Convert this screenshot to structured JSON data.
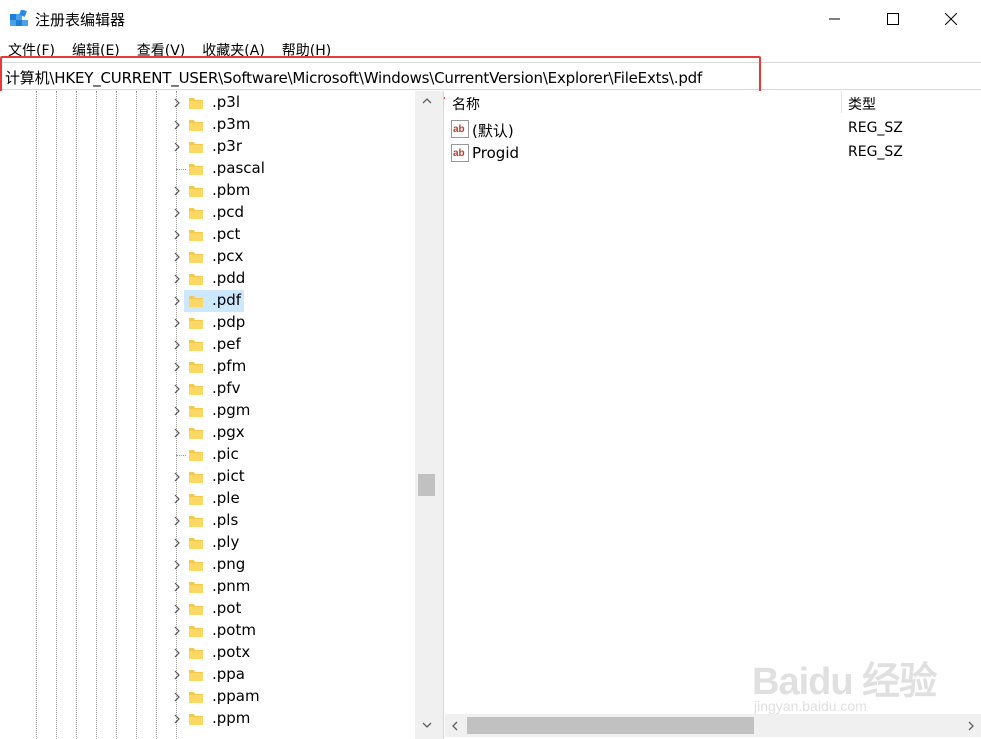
{
  "window": {
    "title": "注册表编辑器",
    "app_icon": "registry-editor-icon",
    "minimize_icon": "minimize-icon",
    "maximize_icon": "maximize-icon",
    "close_icon": "close-icon"
  },
  "menu": [
    {
      "label": "文件(F)"
    },
    {
      "label": "编辑(E)"
    },
    {
      "label": "查看(V)"
    },
    {
      "label": "收藏夹(A)"
    },
    {
      "label": "帮助(H)"
    }
  ],
  "address": {
    "path": "计算机\\HKEY_CURRENT_USER\\Software\\Microsoft\\Windows\\CurrentVersion\\Explorer\\FileExts\\.pdf",
    "highlight_color": "#e8393a"
  },
  "tree": {
    "selected": ".pdf",
    "selected_color": "#cce8ff",
    "items": [
      {
        "label": ".p3l",
        "expandable": true
      },
      {
        "label": ".p3m",
        "expandable": true
      },
      {
        "label": ".p3r",
        "expandable": true
      },
      {
        "label": ".pascal",
        "expandable": false
      },
      {
        "label": ".pbm",
        "expandable": true
      },
      {
        "label": ".pcd",
        "expandable": true
      },
      {
        "label": ".pct",
        "expandable": true
      },
      {
        "label": ".pcx",
        "expandable": true
      },
      {
        "label": ".pdd",
        "expandable": true
      },
      {
        "label": ".pdf",
        "expandable": true
      },
      {
        "label": ".pdp",
        "expandable": true
      },
      {
        "label": ".pef",
        "expandable": true
      },
      {
        "label": ".pfm",
        "expandable": true
      },
      {
        "label": ".pfv",
        "expandable": true
      },
      {
        "label": ".pgm",
        "expandable": true
      },
      {
        "label": ".pgx",
        "expandable": true
      },
      {
        "label": ".pic",
        "expandable": false
      },
      {
        "label": ".pict",
        "expandable": true
      },
      {
        "label": ".ple",
        "expandable": true
      },
      {
        "label": ".pls",
        "expandable": true
      },
      {
        "label": ".ply",
        "expandable": true
      },
      {
        "label": ".png",
        "expandable": true
      },
      {
        "label": ".pnm",
        "expandable": true
      },
      {
        "label": ".pot",
        "expandable": true
      },
      {
        "label": ".potm",
        "expandable": true
      },
      {
        "label": ".potx",
        "expandable": true
      },
      {
        "label": ".ppa",
        "expandable": true
      },
      {
        "label": ".ppam",
        "expandable": true
      },
      {
        "label": ".ppm",
        "expandable": true
      }
    ]
  },
  "values": {
    "columns": {
      "name": "名称",
      "type": "类型"
    },
    "rows": [
      {
        "name": "(默认)",
        "type": "REG_SZ",
        "icon": "string-value-icon"
      },
      {
        "name": "Progid",
        "type": "REG_SZ",
        "icon": "string-value-icon"
      }
    ]
  },
  "watermark": {
    "logo": "Baidu 经验",
    "url": "jingyan.baidu.com"
  }
}
